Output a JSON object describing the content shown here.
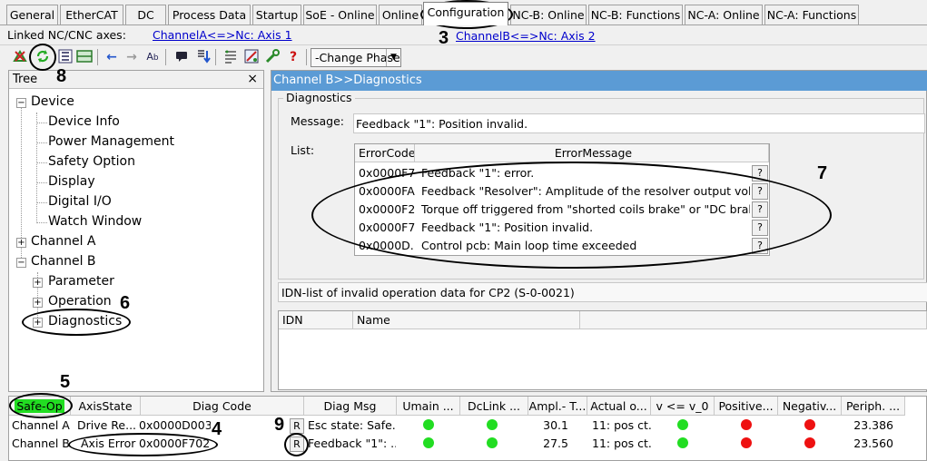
{
  "tabs": [
    "General",
    "EtherCAT",
    "DC",
    "Process Data",
    "Startup",
    "SoE - Online",
    "Online",
    "Configuration",
    "NC-B: Online",
    "NC-B: Functions",
    "NC-A: Online",
    "NC-A: Functions"
  ],
  "linked": {
    "label": "Linked NC/CNC axes:",
    "channel_a": "ChannelA<=>Nc: Axis 1",
    "channel_b": "ChannelB<=>Nc: Axis 2"
  },
  "toolbar": {
    "change_phase": "-Change Phase-",
    "help_glyph": "?"
  },
  "tree": {
    "title": "Tree",
    "close_glyph": "×",
    "device": "Device",
    "device_children": [
      "Device Info",
      "Power Management",
      "Safety Option",
      "Display",
      "Digital I/O",
      "Watch Window"
    ],
    "channel_a": "Channel A",
    "channel_b": "Channel B",
    "channel_b_children": [
      "Parameter",
      "Operation",
      "Diagnostics"
    ]
  },
  "panel": {
    "title": "Channel B>>Diagnostics",
    "group": "Diagnostics",
    "message_label": "Message:",
    "message": "Feedback \"1\": Position invalid.",
    "list_label": "List:",
    "col_code": "ErrorCode",
    "col_message": "ErrorMessage",
    "rows": [
      {
        "code": "0x0000F7...",
        "message": "Feedback \"1\": error."
      },
      {
        "code": "0x0000FA...",
        "message": "Feedback \"Resolver\": Amplitude of the resolver output voltage too small"
      },
      {
        "code": "0x0000F2...",
        "message": "Torque off triggered from \"shorted coils brake\" or \"DC brake\""
      },
      {
        "code": "0x0000F7...",
        "message": "Feedback \"1\": Position invalid."
      },
      {
        "code": "0x0000D...",
        "message": "Control pcb: Main loop time exceeded"
      }
    ],
    "row_button": "?",
    "idn_title": "IDN-list of invalid operation data for CP2 (S-0-0021)",
    "idn_col": "IDN",
    "name_col": "Name"
  },
  "bottom": {
    "headers": [
      "Safe-Op",
      "AxisState",
      "Diag Code",
      "Diag Msg",
      "Umain ...",
      "DcLink ...",
      "Ampl.- T...",
      "Actual o...",
      "v <= v_0",
      "Positive...",
      "Negativ...",
      "Periph. ..."
    ],
    "rows": [
      {
        "channel": "Channel A",
        "state": "Drive Re...",
        "code": "0x0000D003",
        "btn": "R",
        "msg": "Esc state: Safe...",
        "ampl": "30.1",
        "actual": "11: pos ct...",
        "periph": "23.386"
      },
      {
        "channel": "Channel B",
        "state": "Axis Error",
        "code": "0x0000F702",
        "btn": "R",
        "msg": "Feedback \"1\": ...",
        "ampl": "27.5",
        "actual": "11: pos ct...",
        "periph": "23.560"
      }
    ],
    "colors": {
      "green": "#22dd22",
      "red": "#ee1111",
      "safeop": "#22dd22"
    }
  },
  "annotations": [
    "3",
    "4",
    "5",
    "6",
    "7",
    "8",
    "9"
  ]
}
